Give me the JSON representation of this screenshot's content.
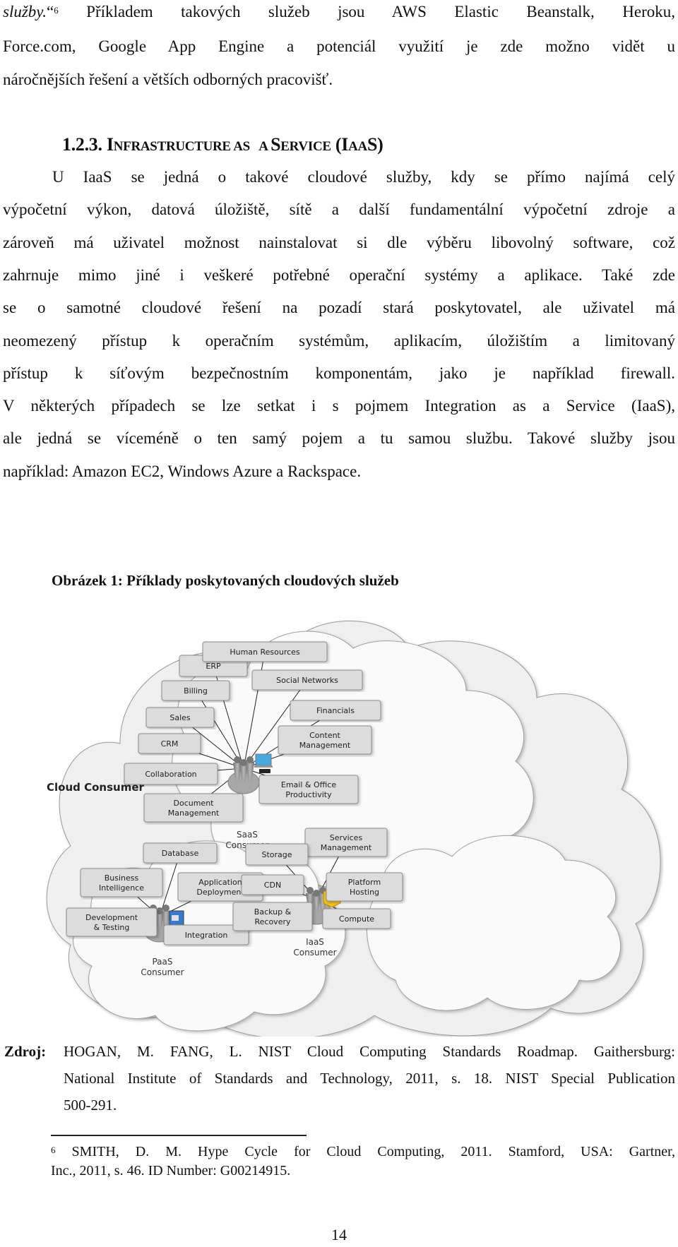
{
  "top_paragraph": {
    "lines": [
      {
        "italic": "služby.",
        "quote": "“",
        "sup": "6",
        "rest": " Příkladem takových služeb jsou AWS Elastic Beanstalk, Heroku,"
      },
      {
        "text": "Force.com, Google App Engine a potenciál využití je zde možno vidět u"
      },
      {
        "text": "náročnějších řešení a větších odborných pracovišť."
      }
    ]
  },
  "section": {
    "number": "1.2.3.",
    "title_parts": [
      {
        "cap": "I",
        "small": "NFRASTRUCTURE AS"
      },
      {
        "cap": " ",
        "small": " "
      },
      {
        "cap": "",
        "small": "A "
      },
      {
        "cap": "S",
        "small": "ERVICE"
      },
      {
        "cap": " (I",
        "small": "AA"
      },
      {
        "cap": "S)",
        "small": ""
      }
    ]
  },
  "body_paragraph": {
    "lines": [
      "U IaaS se jedná o takové cloudové služby, kdy se přímo najímá celý",
      "výpočetní výkon, datová úložiště, sítě a další fundamentální výpočetní zdroje a",
      "zároveň má uživatel možnost nainstalovat si dle výběru libovolný software, což",
      "zahrnuje mimo jiné i veškeré potřebné operační systémy a aplikace. Také zde",
      "se o samotné cloudové řešení na pozadí stará poskytovatel, ale uživatel má",
      "neomezený přístup k operačním systémům, aplikacím, úložištím a limitovaný",
      "přístup k síťovým bezpečnostním komponentám, jako je například firewall.",
      "V některých případech se lze setkat i s pojmem Integration as a Service (IaaS),",
      "ale jedná se víceméně o ten samý pojem a tu samou službu. Takové služby jsou",
      "například: Amazon EC2, Windows Azure a Rackspace."
    ]
  },
  "figure": {
    "caption": "Obrázek 1: Příklady poskytovaných cloudových služeb",
    "outer_label": "Cloud Consumer",
    "colors": {
      "cloud_outer": "#f0f0f0",
      "cloud_inner": "#fafafa",
      "box_fill": "#dcdcdc",
      "box_stroke": "#8c8c8c",
      "hub": "#a8a8a8",
      "laptop": "#4aa8e0",
      "app_window": "#3a78c8",
      "cube": "#f0c020"
    },
    "saas": {
      "label": [
        "SaaS",
        "Consumer"
      ],
      "services": [
        [
          "ERP"
        ],
        [
          "Human Resources"
        ],
        [
          "Billing"
        ],
        [
          "Social Networks"
        ],
        [
          "Sales"
        ],
        [
          "Financials"
        ],
        [
          "CRM"
        ],
        [
          "Content",
          "Management"
        ],
        [
          "Collaboration"
        ],
        [
          "Email & Office",
          "Productivity"
        ],
        [
          "Document",
          "Management"
        ]
      ]
    },
    "paas": {
      "label": [
        "PaaS",
        "Consumer"
      ],
      "services": [
        [
          "Database"
        ],
        [
          "Business",
          "Intelligence"
        ],
        [
          "Application",
          "Deployment"
        ],
        [
          "Development",
          "& Testing"
        ],
        [
          "Integration"
        ]
      ]
    },
    "iaas": {
      "label": [
        "IaaS",
        "Consumer"
      ],
      "services": [
        [
          "Services",
          "Management"
        ],
        [
          "Storage"
        ],
        [
          "Platform",
          "Hosting"
        ],
        [
          "CDN"
        ],
        [
          "Backup &",
          "Recovery"
        ],
        [
          "Compute"
        ]
      ]
    }
  },
  "source": {
    "label": "Zdroj",
    "lines": [
      "HOGAN, M. FANG, L. NIST Cloud Computing Standards Roadmap. Gaithersburg:",
      "National Institute of Standards and Technology, 2011, s. 18. NIST Special Publication",
      "500-291."
    ]
  },
  "footnote": {
    "number": "6",
    "lines": [
      "SMITH, D. M. Hype Cycle for Cloud Computing, 2011. Stamford, USA: Gartner,",
      "Inc., 2011, s. 46. ID Number: G00214915."
    ]
  },
  "page_number": "14"
}
